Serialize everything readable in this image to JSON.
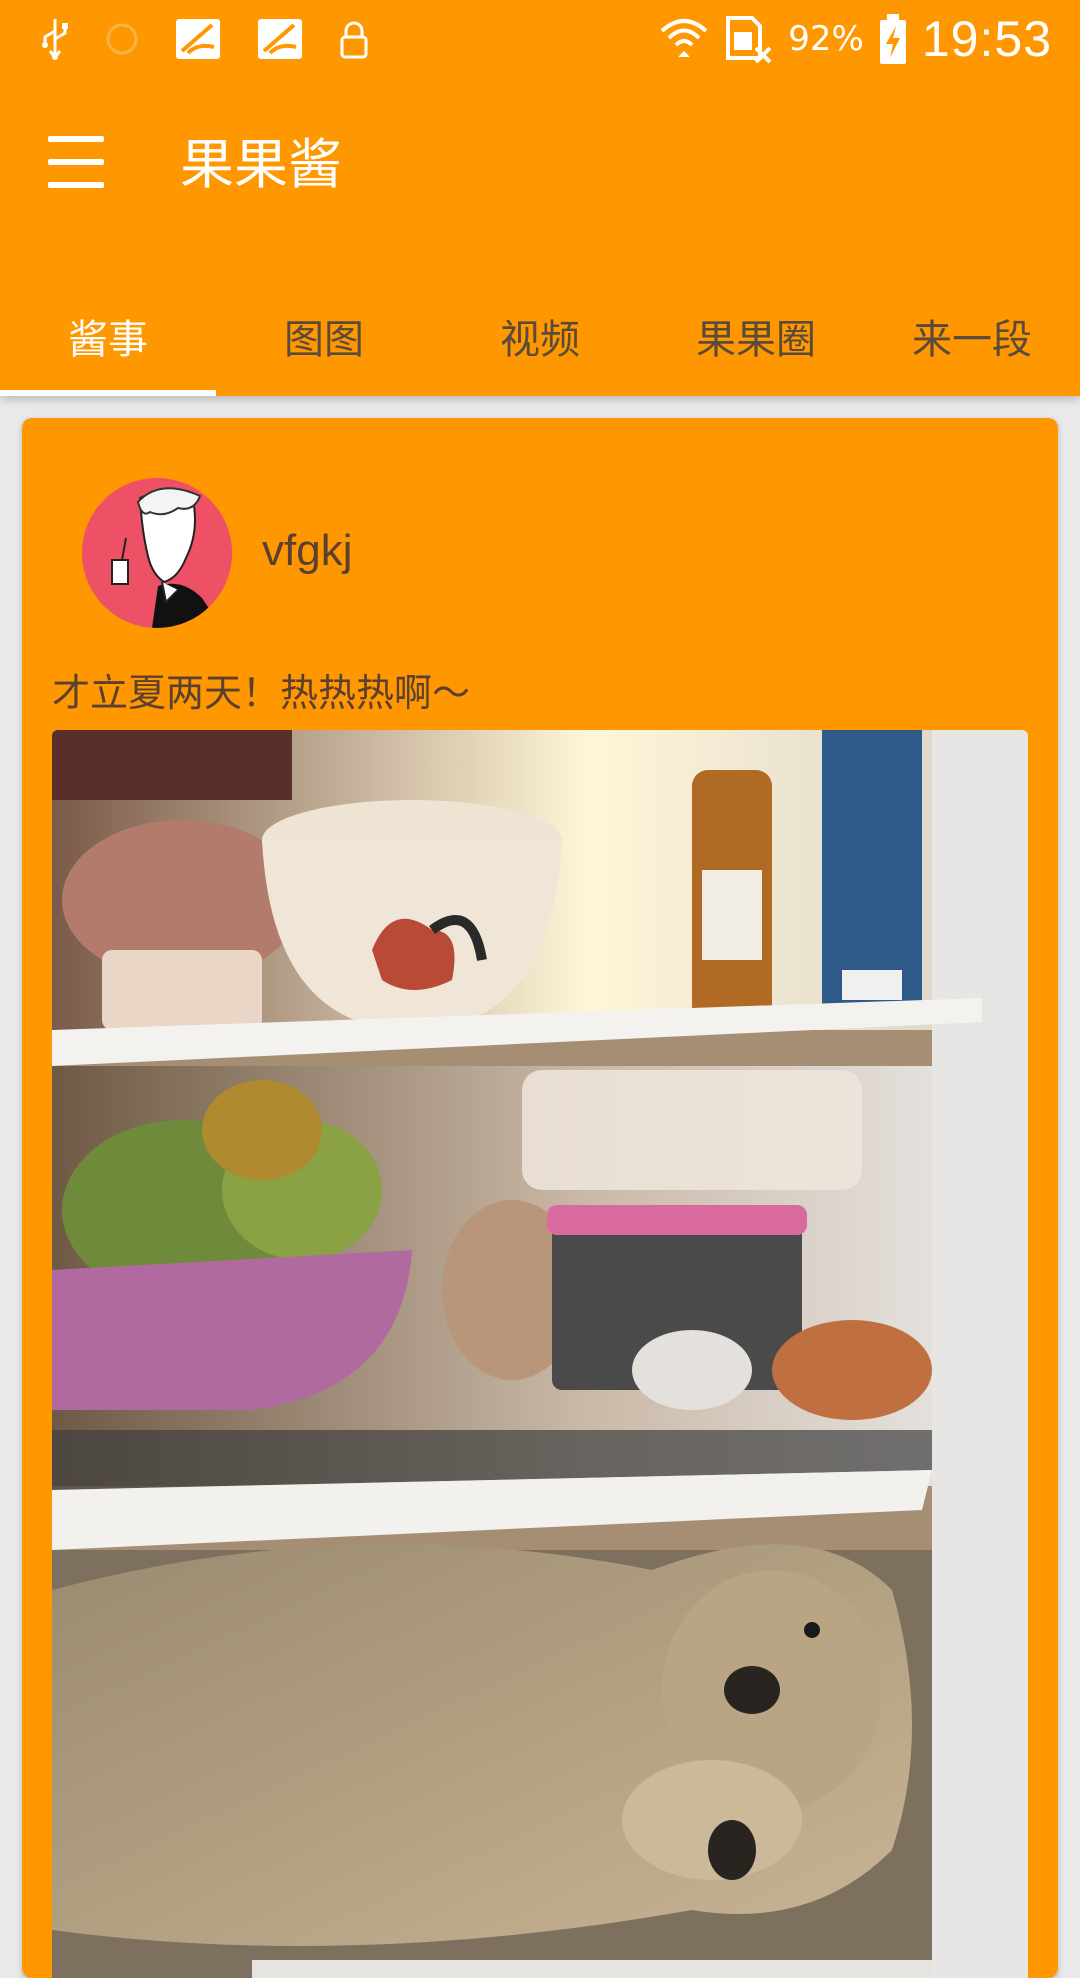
{
  "status_bar": {
    "battery_percent": "92%",
    "time": "19:53",
    "icons_left": [
      "usb-icon",
      "alarm-icon",
      "app-notification-icon",
      "app-notification-icon",
      "lock-icon"
    ],
    "icons_right": [
      "wifi-icon",
      "sim-no-signal-icon",
      "battery-charging-icon"
    ]
  },
  "app_bar": {
    "title": "果果酱",
    "menu_icon": "hamburger-menu-icon"
  },
  "tabs": [
    {
      "label": "酱事",
      "active": true
    },
    {
      "label": "图图",
      "active": false
    },
    {
      "label": "视频",
      "active": false
    },
    {
      "label": "果果圈",
      "active": false
    },
    {
      "label": "来一段",
      "active": false
    }
  ],
  "post": {
    "username": "vfgkj",
    "text": "才立夏两天！热热热啊～"
  },
  "colors": {
    "primary": "#ff9800",
    "tab_inactive": "#5a4a3a",
    "text_dark": "#5b4030",
    "background": "#e9e9e9"
  }
}
